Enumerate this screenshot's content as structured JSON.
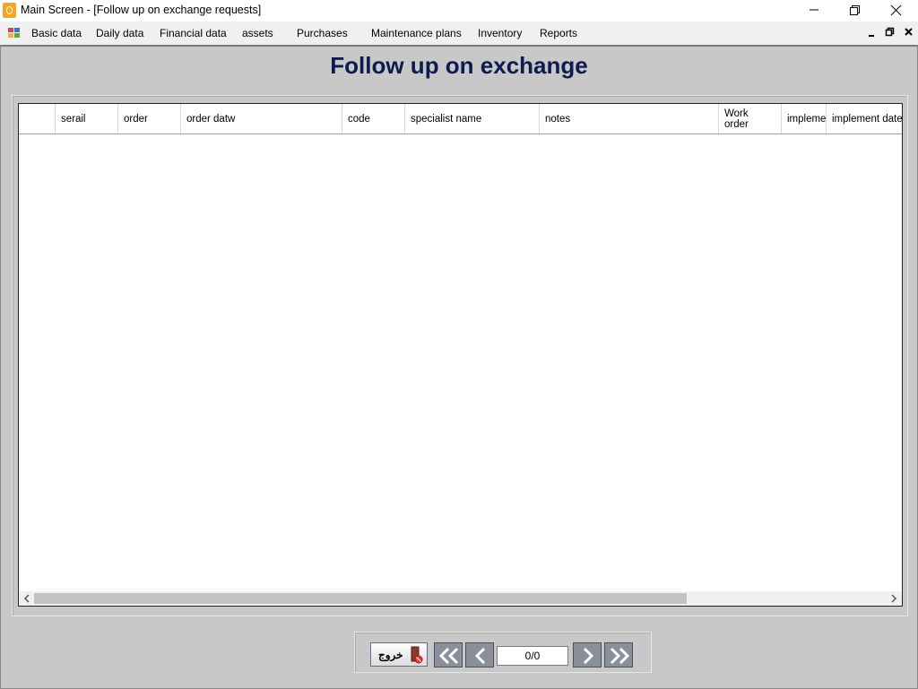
{
  "window": {
    "title": "Main Screen - [Follow up on exchange requests]"
  },
  "menu": {
    "items": [
      "Basic data",
      "Daily data",
      "Financial data",
      "assets",
      "Purchases",
      "Maintenance plans",
      "Inventory",
      "Reports"
    ]
  },
  "form": {
    "title": "Follow up on exchange"
  },
  "grid": {
    "columns": [
      "serail",
      "order",
      "order datw",
      "code",
      "specialist name",
      "notes",
      "Work order",
      "implemer",
      "implement date"
    ],
    "rows": []
  },
  "navigation": {
    "exit_label": "خروج",
    "record_position": "0/0"
  },
  "icons": {
    "first": "double-chevron-left-icon",
    "previous": "chevron-left-icon",
    "next": "chevron-right-icon",
    "last": "double-chevron-right-icon",
    "exit": "exit-door-icon"
  }
}
